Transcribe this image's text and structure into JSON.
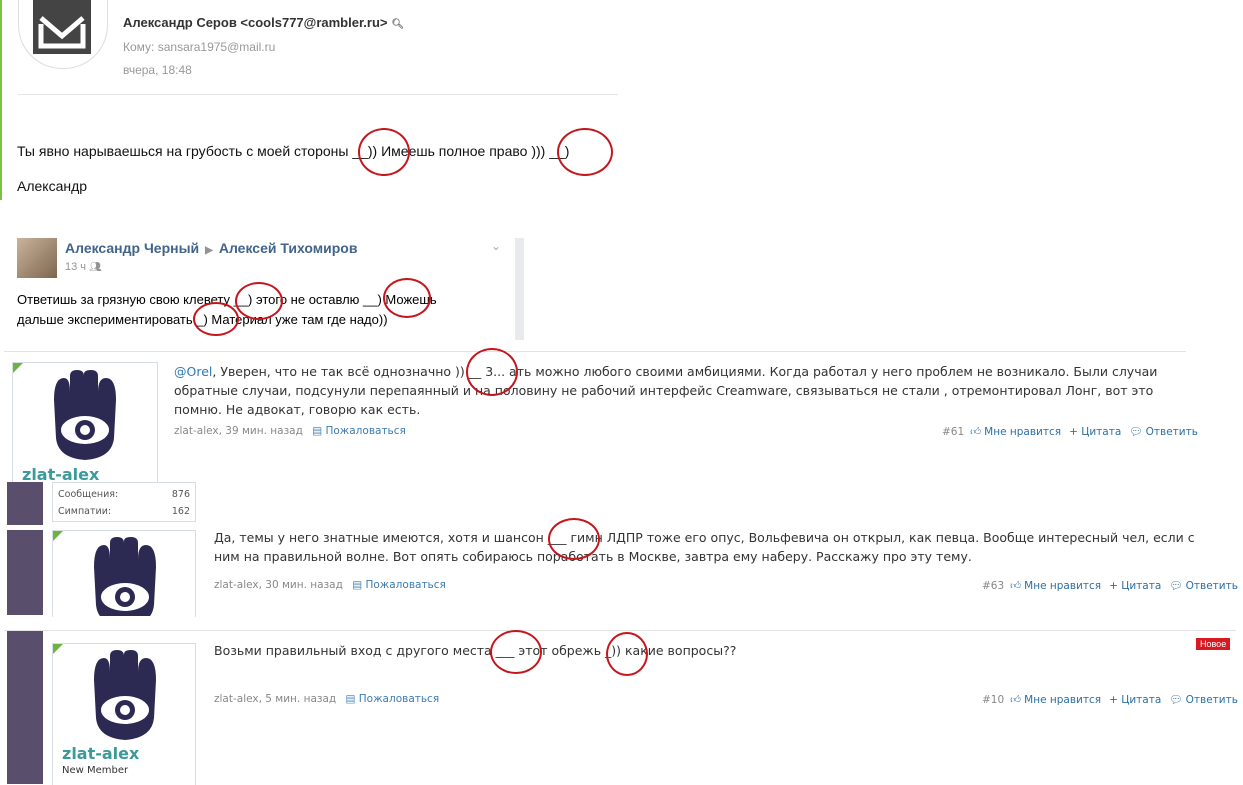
{
  "email": {
    "sender": "Александр Серов <cools777@rambler.ru>",
    "to": "Кому: sansara1975@mail.ru",
    "date": "вчера, 18:48",
    "body": "Ты явно нарываешься на грубость с моей стороны __)) Имеешь полное право ))) __)",
    "signature": "Александр"
  },
  "vk_post": {
    "author": "Александр Черный",
    "recipient": "Алексей Тихомиров",
    "time": "13 ч",
    "text": "Ответишь за грязную свою клевету __) этого не оставлю __) Можешь дальше экспериментировать _) Материал уже там где надо))"
  },
  "forum": {
    "post1": {
      "mention": "@Orel",
      "text": ", Уверен, что не так всё однозначно )) __ 3... ать можно любого своими амбициями. Когда работал у него проблем не возникало. Были случаи обратные случаи, подсунули перепаянный и на половину не рабочий интерфейс Creamware, связываться не стали , отремонтировал Лонг, вот это помню. Не адвокат, говорю как есть.",
      "meta_author": "zlat-alex, 39 мин. назад",
      "report": "Пожаловаться",
      "num": "#61",
      "like": "Мне нравится",
      "quote": "+ Цитата",
      "reply": "Ответить",
      "username": "zlat-alex",
      "stats": [
        {
          "label": "Сообщения:",
          "value": "876"
        },
        {
          "label": "Симпатии:",
          "value": "162"
        }
      ]
    },
    "post2": {
      "text": "Да, темы у него знатные имеются, хотя и шансон ___ гимн ЛДПР тоже его опус, Вольфевича он открыл, как певца. Вообще интересный чел, если с ним на правильной волне. Вот опять собираюсь поработать в Москве, завтра ему наберу. Расскажу про эту тему.",
      "meta_author": "zlat-alex, 30 мин. назад",
      "report": "Пожаловаться",
      "num": "#63",
      "like": "Мне нравится",
      "quote": "+ Цитата",
      "reply": "Ответить"
    },
    "post3": {
      "text": "Возьми правильный вход с другого места ___ этот обрежь _)) какие вопросы??",
      "meta_author": "zlat-alex, 5 мин. назад",
      "report": "Пожаловаться",
      "num": "#10",
      "like": "Мне нравится",
      "quote": "+ Цитата",
      "reply": "Ответить",
      "badge": "Новое",
      "username": "zlat-alex",
      "user_title": "New Member"
    }
  },
  "colors": {
    "annotation": "#c4161c",
    "vk_link": "#42648b",
    "username": "#3b9a9a",
    "sidebar": "#5a4e6d",
    "badge": "#d71921"
  }
}
